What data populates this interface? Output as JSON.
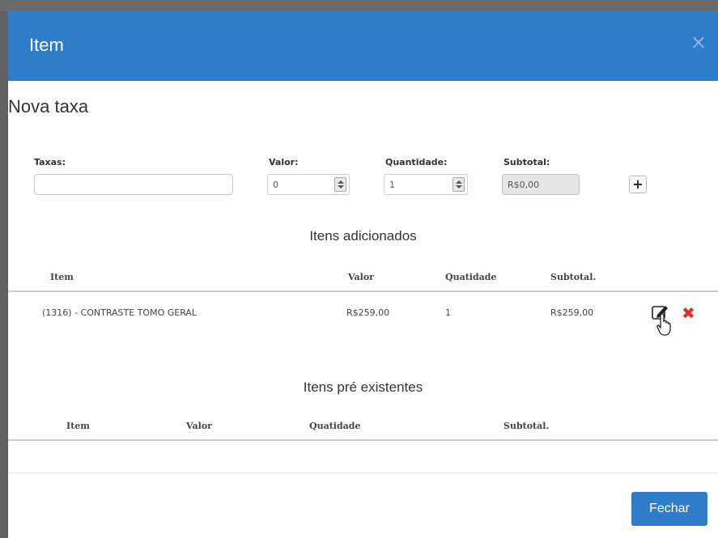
{
  "modal": {
    "title": "Item",
    "close_symbol": "×"
  },
  "form": {
    "section_title": "Nova taxa",
    "labels": {
      "taxas": "Taxas:",
      "valor": "Valor:",
      "quantidade": "Quantidade:",
      "subtotal": "Subtotal:"
    },
    "taxas_value": "",
    "valor_value": "0",
    "quantidade_value": "1",
    "subtotal_value": "R$0,00",
    "add_symbol": "+"
  },
  "added": {
    "heading": "Itens adicionados",
    "columns": [
      "Item",
      "Valor",
      "Quatidade",
      "Subtotal."
    ],
    "rows": [
      {
        "item": "(1316) - CONTRASTE TOMO GERAL",
        "valor": "R$259,00",
        "quantidade": "1",
        "subtotal": "R$259,00"
      }
    ]
  },
  "existing": {
    "heading": "Itens pré existentes",
    "columns": [
      "Item",
      "Valor",
      "Quatidade",
      "Subtotal."
    ]
  },
  "footer": {
    "close_label": "Fechar"
  },
  "colors": {
    "header_bg": "#2f7cc8",
    "delete": "#e0302a"
  },
  "icons": {
    "close": "close-icon",
    "add": "plus-icon",
    "edit": "edit-icon",
    "delete": "delete-icon",
    "cursor": "hand-pointer-icon"
  }
}
